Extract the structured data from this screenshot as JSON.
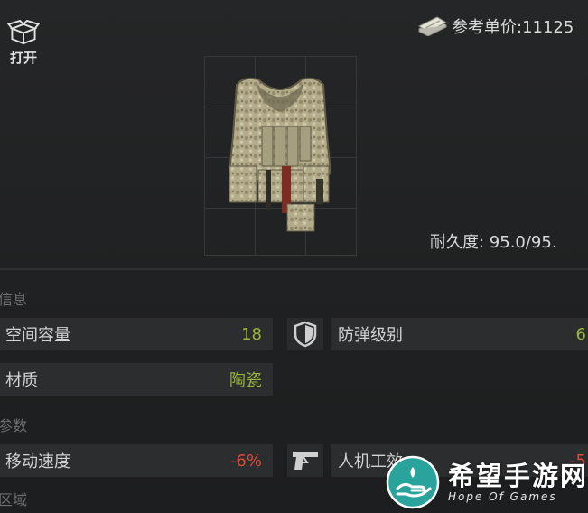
{
  "actions": {
    "open_label": "打开"
  },
  "price": {
    "label": "参考单价:11125"
  },
  "item": {
    "durability": "耐久度: 95.0/95."
  },
  "sections": {
    "info": "信息",
    "params": "参数",
    "zones": "区域"
  },
  "stats": {
    "capacity": {
      "name": "空间容量",
      "value": "18"
    },
    "armor_class": {
      "name": "防弹级别",
      "value": "6"
    },
    "material": {
      "name": "材质",
      "value": "陶瓷"
    },
    "move_speed": {
      "name": "移动速度",
      "value": "-6%"
    },
    "ergonomics": {
      "name": "人机工效",
      "value": "-5"
    }
  },
  "watermark": {
    "cn": "希望手游网",
    "en": "Hope Of Games"
  },
  "colors": {
    "positive": "#97b43f",
    "negative": "#dd4a3a",
    "background": "#202122",
    "panel": "#2c2d2e"
  }
}
